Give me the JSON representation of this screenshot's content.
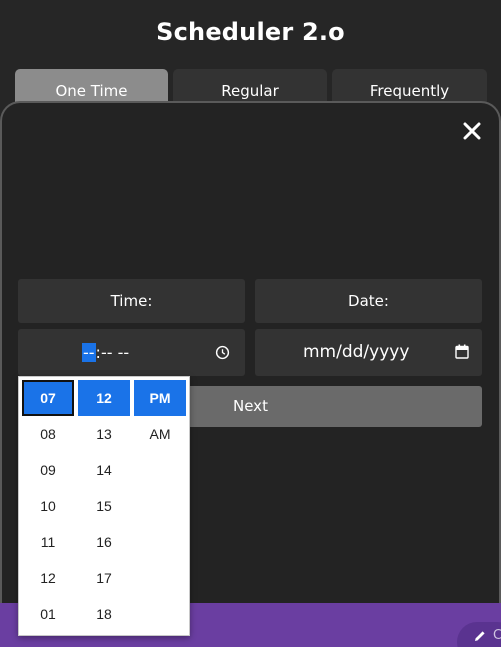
{
  "header": {
    "title": "Scheduler 2.o"
  },
  "tabs": [
    {
      "label": "One Time",
      "active": true
    },
    {
      "label": "Regular",
      "active": false
    },
    {
      "label": "Frequently",
      "active": false
    }
  ],
  "form": {
    "time_label": "Time:",
    "date_label": "Date:",
    "time_input": {
      "hour_segment": "--",
      "rest": ":-- --"
    },
    "date_input": {
      "placeholder": "mm/dd/yyyy"
    },
    "next_label": "Next"
  },
  "time_picker": {
    "hours": [
      "07",
      "08",
      "09",
      "10",
      "11",
      "12",
      "01"
    ],
    "minutes": [
      "12",
      "13",
      "14",
      "15",
      "16",
      "17",
      "18"
    ],
    "meridiem": [
      "PM",
      "AM"
    ],
    "selected_hour": "07",
    "selected_minute": "12",
    "selected_meridiem": "PM"
  },
  "colors": {
    "background": "#262626",
    "active_tab": "#8c8c8c",
    "accent_blue": "#1a73e8",
    "bottom_bar": "#6a3ea1"
  },
  "icons": {
    "close": "close-icon",
    "clock": "clock-icon",
    "calendar": "calendar-icon",
    "edit": "edit-icon"
  },
  "fab": {
    "label": "C"
  }
}
